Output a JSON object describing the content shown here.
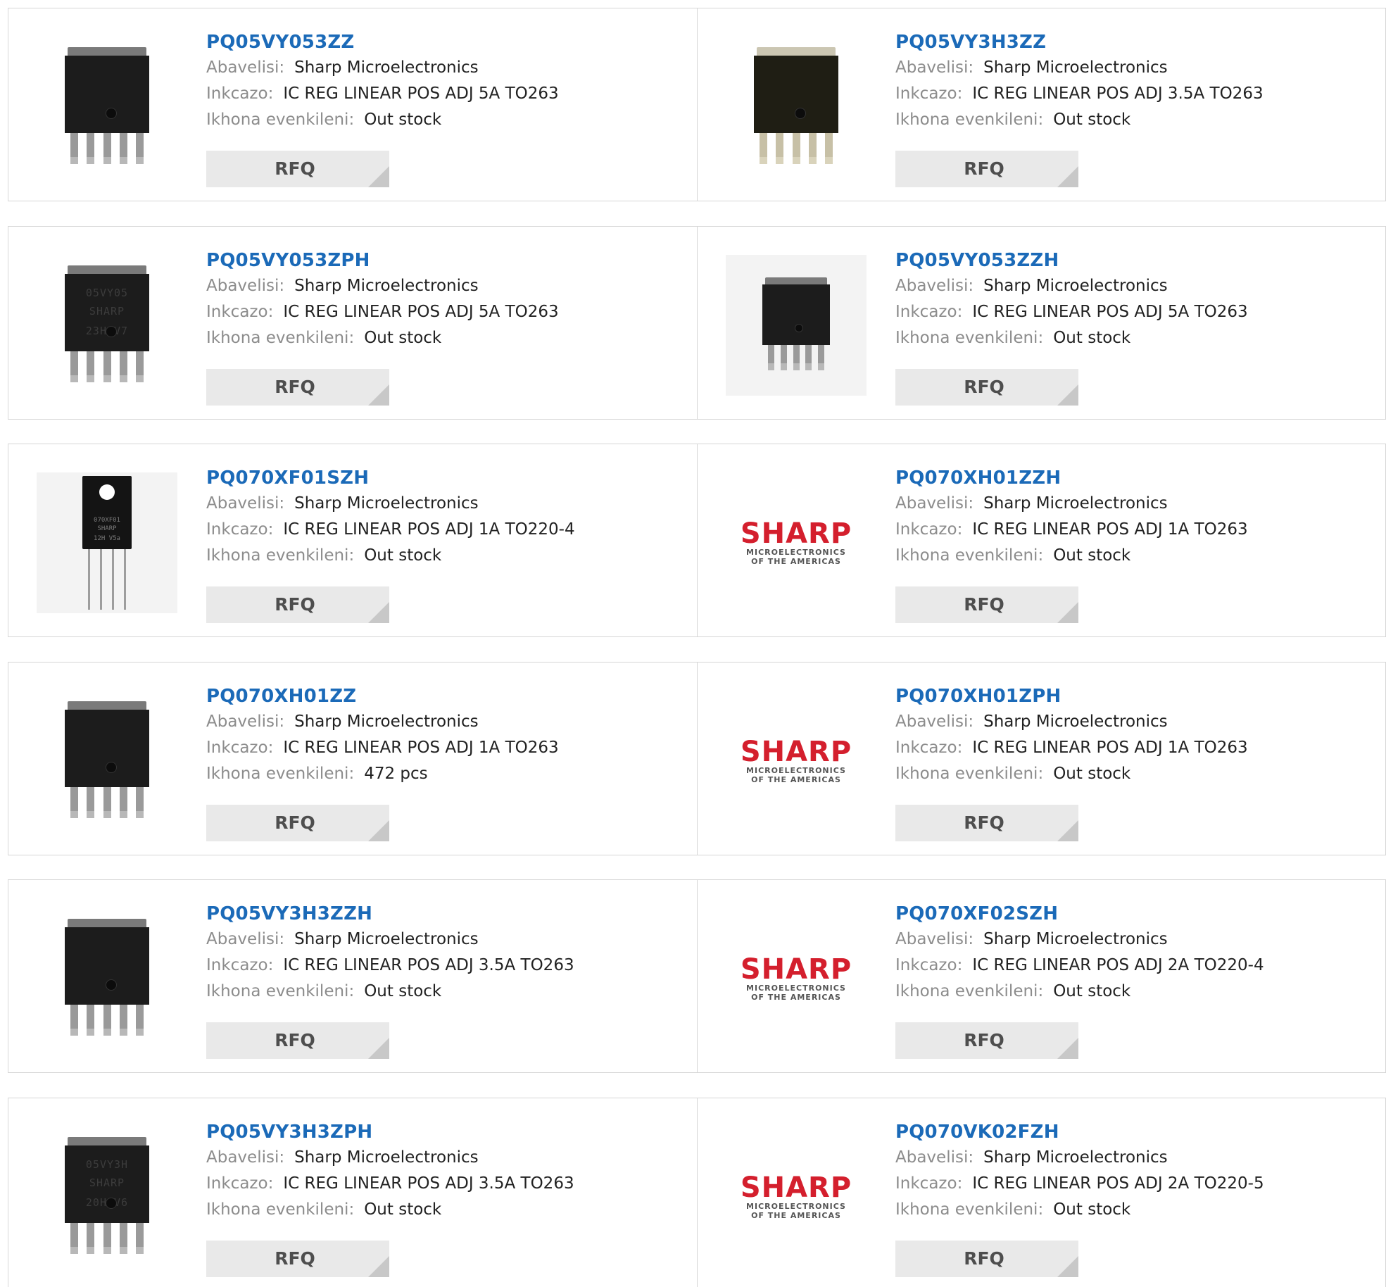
{
  "labels": {
    "manufacturer": "Abavelisi:",
    "description": "Inkcazo:",
    "stock": "Ikhona evenkileni:",
    "rfq": "RFQ"
  },
  "products": [
    {
      "part": "PQ05VY053ZZ",
      "manufacturer": "Sharp Microelectronics",
      "description": "IC REG LINEAR POS ADJ 5A TO263",
      "stock": "Out stock",
      "image": "to263-chip"
    },
    {
      "part": "PQ05VY3H3ZZ",
      "manufacturer": "Sharp Microelectronics",
      "description": "IC REG LINEAR POS ADJ 3.5A TO263",
      "stock": "Out stock",
      "image": "to263-chip-gold"
    },
    {
      "part": "PQ05VY053ZPH",
      "manufacturer": "Sharp Microelectronics",
      "description": "IC REG LINEAR POS ADJ 5A TO263",
      "stock": "Out stock",
      "image": "to263-chip"
    },
    {
      "part": "PQ05VY053ZZH",
      "manufacturer": "Sharp Microelectronics",
      "description": "IC REG LINEAR POS ADJ 5A TO263",
      "stock": "Out stock",
      "image": "to263-chip-small"
    },
    {
      "part": "PQ070XF01SZH",
      "manufacturer": "Sharp Microelectronics",
      "description": "IC REG LINEAR POS ADJ 1A TO220-4",
      "stock": "Out stock",
      "image": "to220-chip"
    },
    {
      "part": "PQ070XH01ZZH",
      "manufacturer": "Sharp Microelectronics",
      "description": "IC REG LINEAR POS ADJ 1A TO263",
      "stock": "Out stock",
      "image": "sharp-logo"
    },
    {
      "part": "PQ070XH01ZZ",
      "manufacturer": "Sharp Microelectronics",
      "description": "IC REG LINEAR POS ADJ 1A TO263",
      "stock": "472 pcs",
      "image": "to263-chip"
    },
    {
      "part": "PQ070XH01ZPH",
      "manufacturer": "Sharp Microelectronics",
      "description": "IC REG LINEAR POS ADJ 1A TO263",
      "stock": "Out stock",
      "image": "sharp-logo"
    },
    {
      "part": "PQ05VY3H3ZZH",
      "manufacturer": "Sharp Microelectronics",
      "description": "IC REG LINEAR POS ADJ 3.5A TO263",
      "stock": "Out stock",
      "image": "to263-chip"
    },
    {
      "part": "PQ070XF02SZH",
      "manufacturer": "Sharp Microelectronics",
      "description": "IC REG LINEAR POS ADJ 2A TO220-4",
      "stock": "Out stock",
      "image": "sharp-logo"
    },
    {
      "part": "PQ05VY3H3ZPH",
      "manufacturer": "Sharp Microelectronics",
      "description": "IC REG LINEAR POS ADJ 3.5A TO263",
      "stock": "Out stock",
      "image": "to263-chip"
    },
    {
      "part": "PQ070VK02FZH",
      "manufacturer": "Sharp Microelectronics",
      "description": "IC REG LINEAR POS ADJ 2A TO220-5",
      "stock": "Out stock",
      "image": "sharp-logo"
    }
  ],
  "logo": {
    "word": "SHARP",
    "line1": "MICROELECTRONICS",
    "line2": "OF THE AMERICAS"
  },
  "chip_markings": {
    "PQ05VY053ZPH": [
      "05VY05",
      "SHARP",
      "23H   V7"
    ],
    "PQ05VY3H3ZPH": [
      "05VY3H",
      "SHARP",
      "20H   V6"
    ],
    "PQ070XF01SZH": [
      "070XF01",
      "SHARP",
      "12H  V5a"
    ]
  },
  "colors": {
    "link": "#1b6ab8",
    "brand": "#d41f2d",
    "button": "#e9e9e9"
  }
}
